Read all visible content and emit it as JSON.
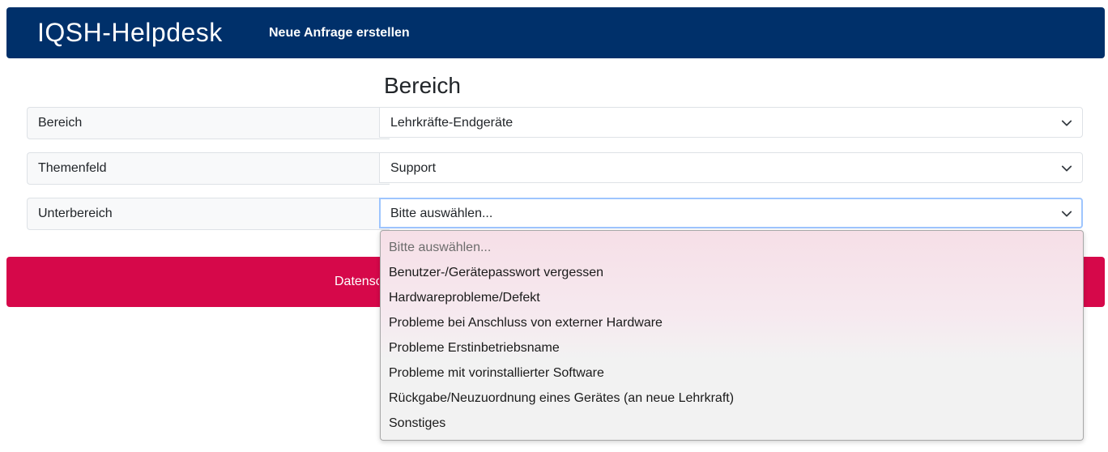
{
  "navbar": {
    "brand": "IQSH-Helpdesk",
    "new_request_link": "Neue Anfrage erstellen"
  },
  "section": {
    "title": "Bereich"
  },
  "fields": [
    {
      "label": "Bereich",
      "value": "Lehrkräfte-Endgeräte"
    },
    {
      "label": "Themenfeld",
      "value": "Support"
    },
    {
      "label": "Unterbereich",
      "value": "Bitte auswählen..."
    }
  ],
  "privacy_bar": {
    "text_visible": "Datensc"
  },
  "dropdown": {
    "options": [
      "Bitte auswählen...",
      "Benutzer-/Gerätepasswort vergessen",
      "Hardwareprobleme/Defekt",
      "Probleme bei Anschluss von externer Hardware",
      "Probleme Erstinbetriebsname",
      "Probleme mit vorinstallierter Software",
      "Rückgabe/Neuzuordnung eines Gerätes (an neue Lehrkraft)",
      "Sonstiges"
    ]
  },
  "colors": {
    "navbar": "#00306a",
    "accent_bar": "#d6084a",
    "focus_border": "#9ec5fe"
  },
  "icons": {
    "select_arrow": "chevron-down-icon"
  }
}
